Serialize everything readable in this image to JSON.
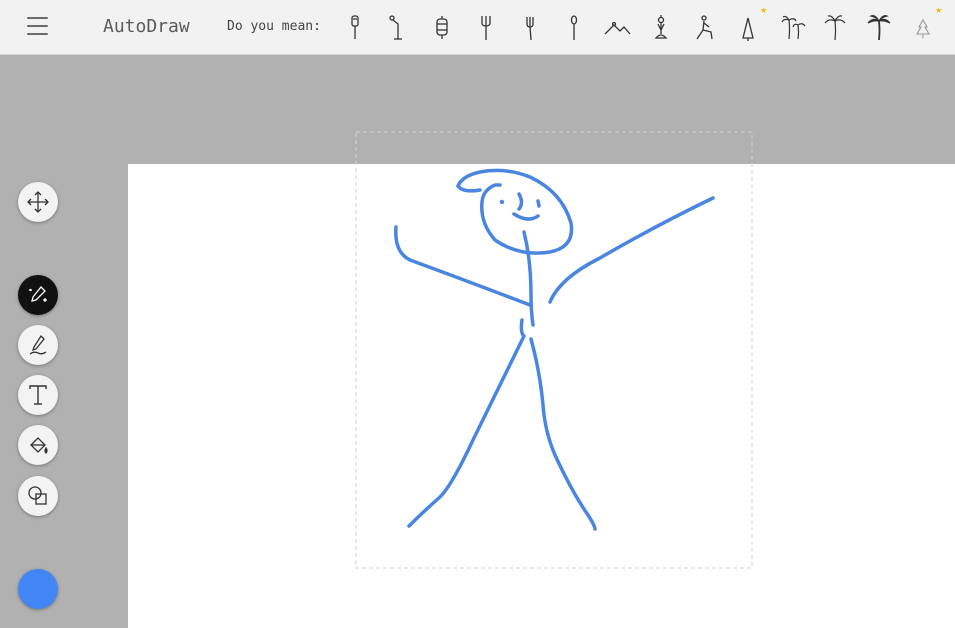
{
  "header": {
    "app_title": "AutoDraw",
    "suggest_label": "Do you mean:"
  },
  "suggestions": [
    {
      "icon": "microphone-icon"
    },
    {
      "icon": "mic-stand-icon"
    },
    {
      "icon": "lantern-icon"
    },
    {
      "icon": "fork-icon"
    },
    {
      "icon": "fork-icon"
    },
    {
      "icon": "spoon-icon"
    },
    {
      "icon": "yoga-pose-icon"
    },
    {
      "icon": "meditation-pose-icon"
    },
    {
      "icon": "running-pose-icon"
    },
    {
      "icon": "tent-icon",
      "starred": true
    },
    {
      "icon": "palm-trees-icon"
    },
    {
      "icon": "palm-tree-icon"
    },
    {
      "icon": "palm-tree-filled-icon"
    },
    {
      "icon": "pine-tree-icon",
      "starred": true
    }
  ],
  "toolbar": {
    "tools": [
      "select-move-icon",
      "autodraw-icon",
      "draw-pen-icon",
      "text-icon",
      "fill-bucket-icon",
      "shapes-icon"
    ],
    "active_tool": "autodraw-icon",
    "current_color": "#4285f4"
  },
  "colors": {
    "stroke": "#4a86e0",
    "accent_star": "#f5b400"
  }
}
